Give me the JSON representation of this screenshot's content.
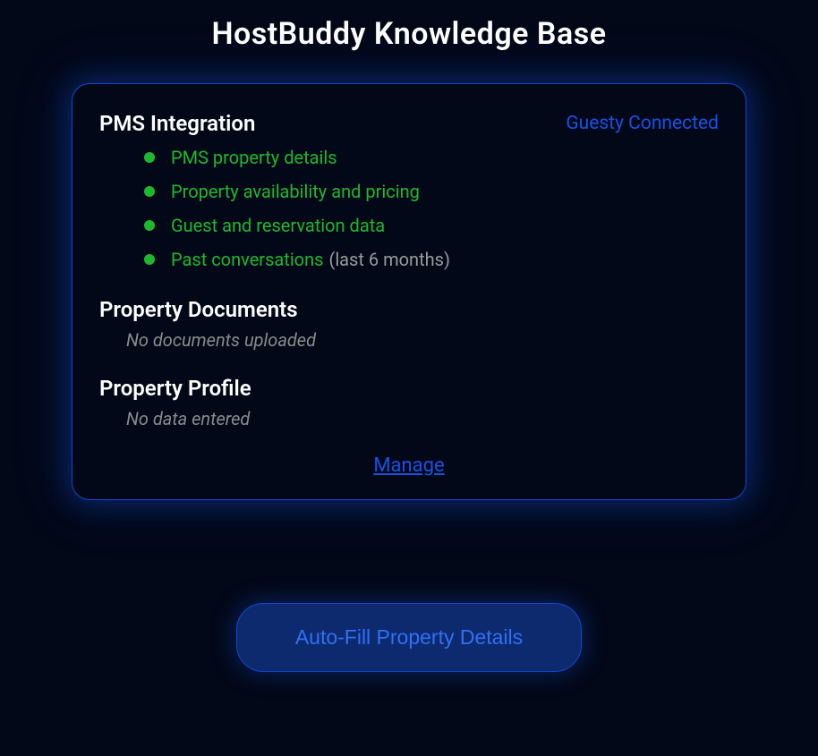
{
  "page": {
    "title": "HostBuddy Knowledge Base"
  },
  "card": {
    "pms": {
      "title": "PMS Integration",
      "status": "Guesty Connected",
      "items": [
        {
          "label": "PMS property details",
          "suffix": ""
        },
        {
          "label": "Property availability and pricing",
          "suffix": ""
        },
        {
          "label": "Guest and reservation data",
          "suffix": ""
        },
        {
          "label": "Past conversations",
          "suffix": "(last 6 months)"
        }
      ]
    },
    "documents": {
      "title": "Property Documents",
      "empty": "No documents uploaded"
    },
    "profile": {
      "title": "Property Profile",
      "empty": "No data entered"
    },
    "manage_label": "Manage"
  },
  "actions": {
    "autofill": "Auto-Fill Property Details"
  }
}
